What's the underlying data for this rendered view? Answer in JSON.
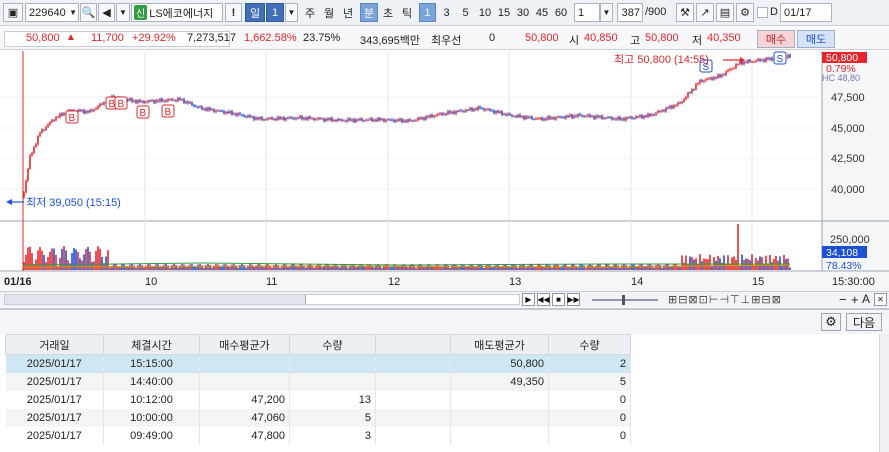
{
  "toolbar": {
    "code": "229640",
    "badge": "신",
    "name": "LS에코에너지",
    "period_day": "일",
    "period_num": "1",
    "week": "주",
    "month": "월",
    "year": "년",
    "minute": "분",
    "second": "초",
    "tick": "틱",
    "intervals": [
      "1",
      "3",
      "5",
      "10",
      "15",
      "30",
      "45",
      "60"
    ],
    "custom_interval": "1",
    "count": "387",
    "count_max": "/900",
    "date": "01/17",
    "d_label": "D"
  },
  "quote": {
    "price": "50,800",
    "change": "11,700",
    "rate": "+29.92%",
    "volume": "7,273,517",
    "vol_rate": "1,662.58%",
    "turnover": "23.75%",
    "amount": "343,695백만",
    "best": "최우선",
    "best_val": "0",
    "cur": "50,800",
    "open_lbl": "시",
    "open": "40,850",
    "high_lbl": "고",
    "high": "50,800",
    "low_lbl": "저",
    "low": "40,350",
    "buy": "매수",
    "sell": "매도"
  },
  "chart": {
    "high_label": "최고 50,800 (14:55)",
    "low_label": "최저 39,050 (15:15)",
    "price_ticks": [
      "47,500",
      "45,000",
      "42,500",
      "40,000"
    ],
    "price_ticks_val": [
      47500,
      45000,
      42500,
      40000
    ],
    "current_price": "50,800",
    "current_pct": "0.79%",
    "hc_label": "HC 48,80",
    "volume_tick": "250,000",
    "volume_current": "34,108",
    "volume_pct": "78.43%",
    "time_labels": [
      "01/16",
      "10",
      "11",
      "12",
      "13",
      "14",
      "15"
    ],
    "time_end": "15:30:00",
    "marker_buy": "B",
    "marker_sell": "S"
  },
  "panel": {
    "next": "다음",
    "headers": [
      "거래일",
      "체결시간",
      "매수평균가",
      "수량",
      "",
      "매도평균가",
      "수량"
    ],
    "rows": [
      {
        "date": "2025/01/17",
        "time": "15:15:00",
        "buy_avg": "",
        "buy_qty": "",
        "sell_avg": "50,800",
        "sell_qty": "2"
      },
      {
        "date": "2025/01/17",
        "time": "14:40:00",
        "buy_avg": "",
        "buy_qty": "",
        "sell_avg": "49,350",
        "sell_qty": "5"
      },
      {
        "date": "2025/01/17",
        "time": "10:12:00",
        "buy_avg": "47,200",
        "buy_qty": "13",
        "sell_avg": "",
        "sell_qty": "0"
      },
      {
        "date": "2025/01/17",
        "time": "10:00:00",
        "buy_avg": "47,060",
        "buy_qty": "5",
        "sell_avg": "",
        "sell_qty": "0"
      },
      {
        "date": "2025/01/17",
        "time": "09:49:00",
        "buy_avg": "47,800",
        "buy_qty": "3",
        "sell_avg": "",
        "sell_qty": "0"
      }
    ]
  },
  "colors": {
    "up": "#e3262b",
    "down": "#1b4fd6",
    "accent": "#3f6fb7"
  }
}
